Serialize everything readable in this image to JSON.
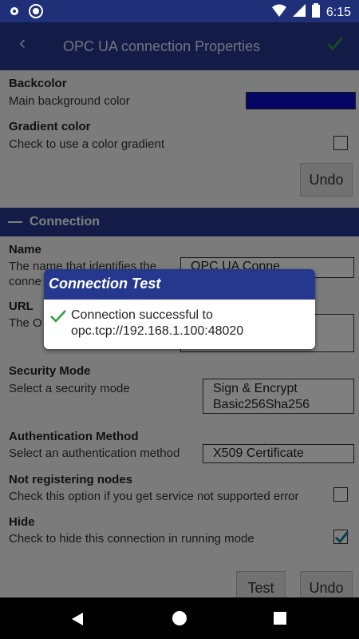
{
  "status": {
    "time": "6:15"
  },
  "appbar": {
    "title": "OPC UA connection Properties"
  },
  "backcolor": {
    "label": "Backcolor",
    "desc": "Main background color",
    "color": "#0a0ac8"
  },
  "gradient": {
    "label": "Gradient color",
    "desc": "Check to use a color gradient",
    "checked": false
  },
  "undo_top": {
    "label": "Undo"
  },
  "section": {
    "title": "Connection"
  },
  "name": {
    "label": "Name",
    "desc_line1": "The name that identifies the",
    "desc_line2": "conne",
    "value": "OPC UA Conne"
  },
  "url": {
    "label": "URL",
    "desc": "The O"
  },
  "security": {
    "label": "Security Mode",
    "desc": "Select a security mode",
    "value_line1": "Sign & Encrypt",
    "value_line2": "Basic256Sha256"
  },
  "auth": {
    "label": "Authentication Method",
    "desc": "Select an authentication method",
    "value": "X509 Certificate"
  },
  "not_registering": {
    "label": "Not registering nodes",
    "desc": "Check this option if you get service not supported error",
    "checked": false
  },
  "hide": {
    "label": "Hide",
    "desc": "Check to hide this connection in running mode",
    "checked": true
  },
  "buttons": {
    "test": "Test",
    "undo": "Undo"
  },
  "dialog": {
    "title": "Connection Test",
    "message_line1": "Connection successful to",
    "message_line2": "opc.tcp://192.168.1.100:48020"
  },
  "colors": {
    "primary": "#26388e",
    "accent_check": "#2e9d3b"
  }
}
